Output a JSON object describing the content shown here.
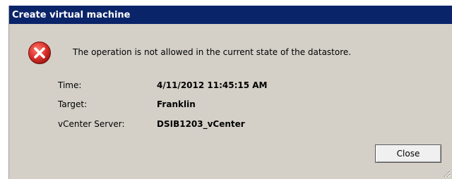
{
  "window": {
    "title": "Create virtual machine"
  },
  "error": {
    "icon": "error-icon",
    "message": "The operation is not allowed in the current state of the datastore."
  },
  "details": [
    {
      "label": "Time:",
      "value": "4/11/2012 11:45:15 AM"
    },
    {
      "label": "Target:",
      "value": "Franklin"
    },
    {
      "label": "vCenter Server:",
      "value": "DSIB1203_vCenter"
    }
  ],
  "buttons": {
    "close_label": "Close"
  },
  "colors": {
    "titlebar": "#0a246a",
    "dialog_bg": "#d4d0c8",
    "error_red": "#d9302b"
  }
}
